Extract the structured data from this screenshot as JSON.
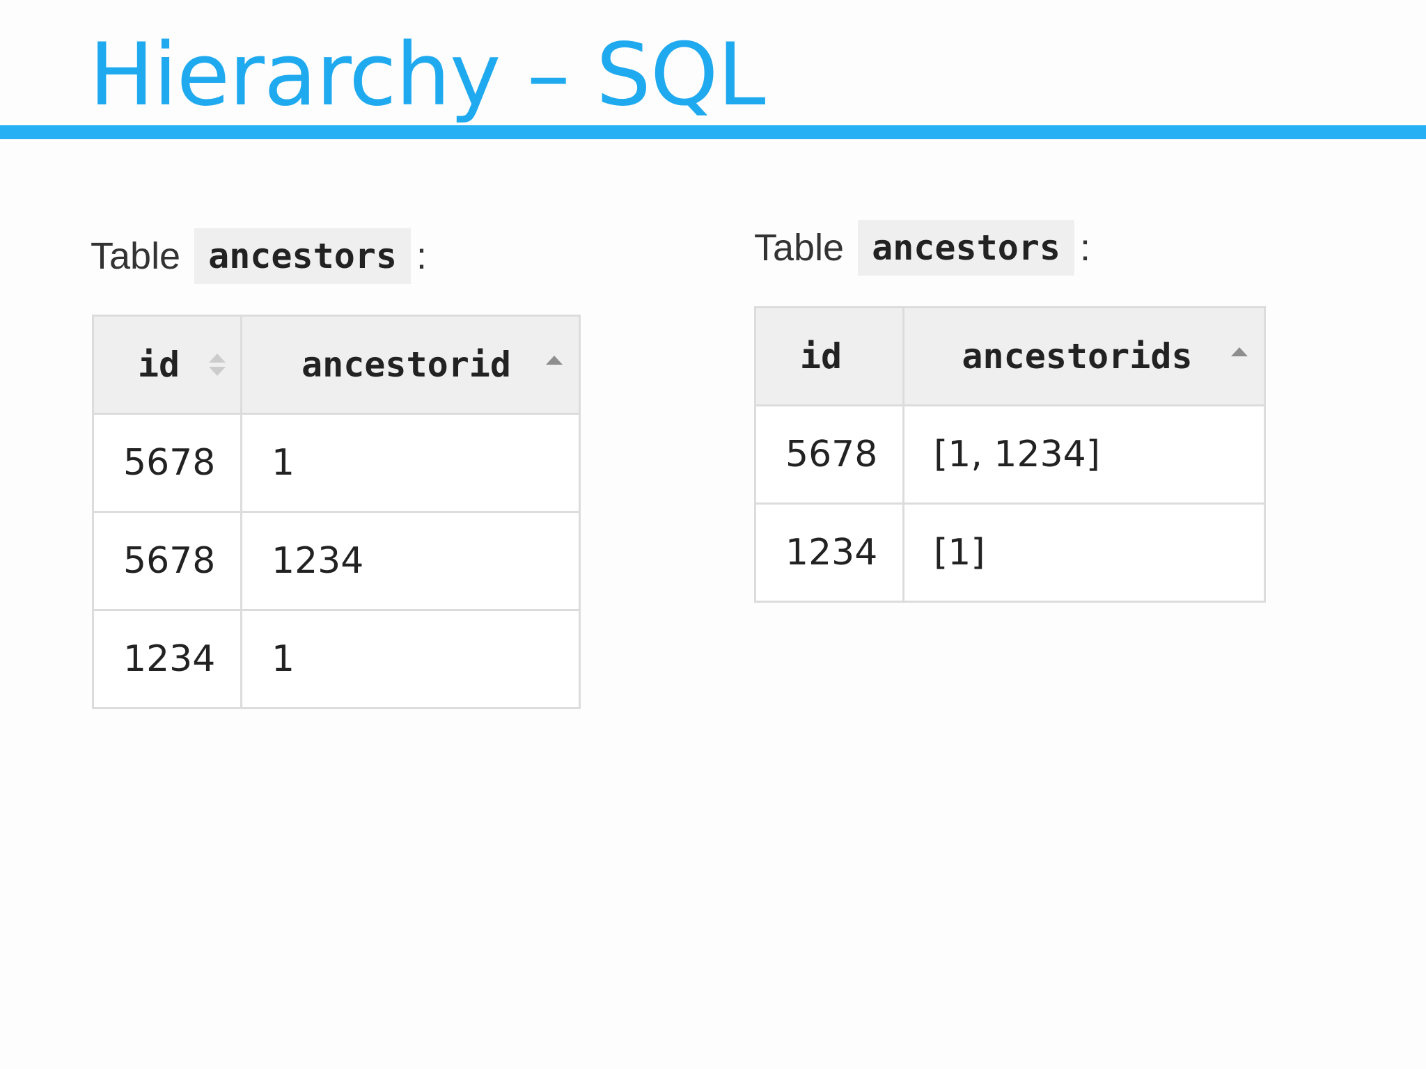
{
  "slide": {
    "title": "Hierarchy – SQL"
  },
  "left": {
    "caption_prefix": "Table",
    "table_name": "ancestors",
    "caption_suffix": ":",
    "columns": [
      "id",
      "ancestorid"
    ],
    "rows": [
      [
        "5678",
        "1"
      ],
      [
        "5678",
        "1234"
      ],
      [
        "1234",
        "1"
      ]
    ]
  },
  "right": {
    "caption_prefix": "Table",
    "table_name": "ancestors",
    "caption_suffix": ":",
    "columns": [
      "id",
      "ancestorids"
    ],
    "rows": [
      [
        "5678",
        "[1, 1234]"
      ],
      [
        "1234",
        "[1]"
      ]
    ]
  },
  "icons": {
    "sort_neutral": "sort-both-icon",
    "sort_ascending": "sort-ascending-icon"
  },
  "colors": {
    "accent": "#28b0f4",
    "title": "#1fa9ef",
    "header_bg": "#efefef",
    "border": "#dcdcdc"
  }
}
